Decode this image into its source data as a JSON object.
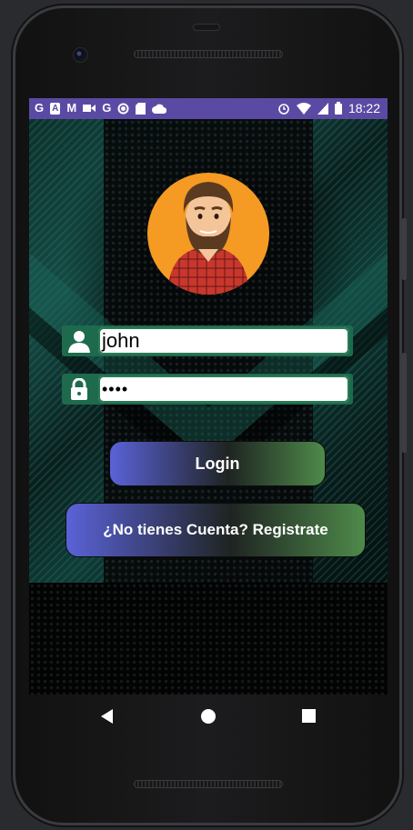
{
  "status_bar": {
    "time": "18:22",
    "left_icons": [
      "G",
      "A",
      "M",
      "video-icon",
      "G",
      "circle-icon",
      "sd-card-icon",
      "cloud-icon"
    ],
    "right_icons": [
      "alarm-icon",
      "wifi-icon",
      "signal-icon",
      "battery-icon"
    ]
  },
  "login": {
    "username_value": "john",
    "password_value": "••••",
    "login_button": "Login",
    "register_button": "¿No tienes Cuenta? Registrate"
  },
  "nav": [
    "back-icon",
    "home-icon",
    "recents-icon"
  ],
  "colors": {
    "status_bar": "#5a4aa4",
    "avatar_bg": "#f59a23",
    "field_bg": "#1d6b4c",
    "button_start": "#5a62d8",
    "button_end": "#4e8a4a"
  }
}
